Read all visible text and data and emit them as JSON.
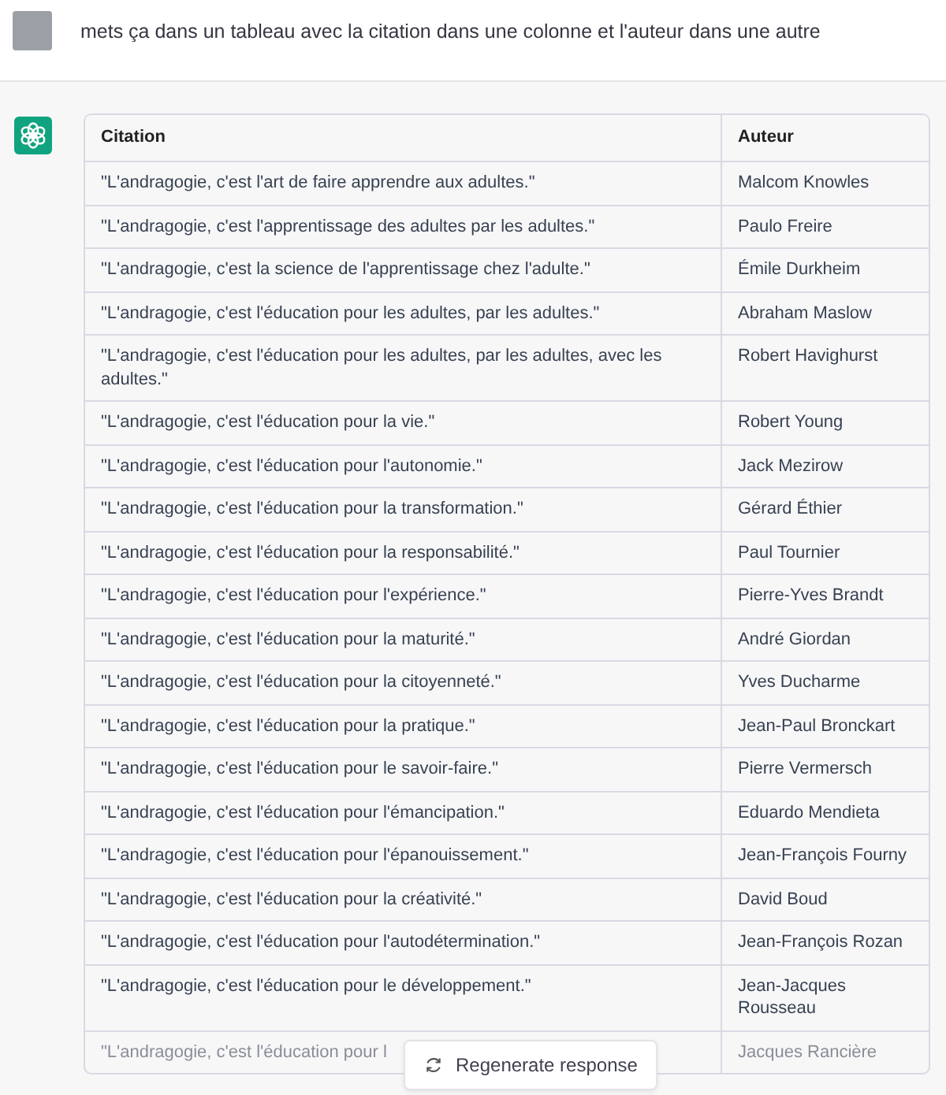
{
  "user_message": {
    "text": "mets ça dans un tableau avec la citation dans une colonne et l'auteur dans une autre"
  },
  "table": {
    "columns": [
      "Citation",
      "Auteur"
    ],
    "rows": [
      [
        "\"L'andragogie, c'est l'art de faire apprendre aux adultes.\"",
        "Malcom Knowles"
      ],
      [
        "\"L'andragogie, c'est l'apprentissage des adultes par les adultes.\"",
        "Paulo Freire"
      ],
      [
        "\"L'andragogie, c'est la science de l'apprentissage chez l'adulte.\"",
        "Émile Durkheim"
      ],
      [
        "\"L'andragogie, c'est l'éducation pour les adultes, par les adultes.\"",
        "Abraham Maslow"
      ],
      [
        "\"L'andragogie, c'est l'éducation pour les adultes, par les adultes, avec les adultes.\"",
        "Robert Havighurst"
      ],
      [
        "\"L'andragogie, c'est l'éducation pour la vie.\"",
        "Robert Young"
      ],
      [
        "\"L'andragogie, c'est l'éducation pour l'autonomie.\"",
        "Jack Mezirow"
      ],
      [
        "\"L'andragogie, c'est l'éducation pour la transformation.\"",
        "Gérard Éthier"
      ],
      [
        "\"L'andragogie, c'est l'éducation pour la responsabilité.\"",
        "Paul Tournier"
      ],
      [
        "\"L'andragogie, c'est l'éducation pour l'expérience.\"",
        "Pierre-Yves Brandt"
      ],
      [
        "\"L'andragogie, c'est l'éducation pour la maturité.\"",
        "André Giordan"
      ],
      [
        "\"L'andragogie, c'est l'éducation pour la citoyenneté.\"",
        "Yves Ducharme"
      ],
      [
        "\"L'andragogie, c'est l'éducation pour la pratique.\"",
        "Jean-Paul Bronckart"
      ],
      [
        "\"L'andragogie, c'est l'éducation pour le savoir-faire.\"",
        "Pierre Vermersch"
      ],
      [
        "\"L'andragogie, c'est l'éducation pour l'émancipation.\"",
        "Eduardo Mendieta"
      ],
      [
        "\"L'andragogie, c'est l'éducation pour l'épanouissement.\"",
        "Jean-François Fourny"
      ],
      [
        "\"L'andragogie, c'est l'éducation pour la créativité.\"",
        "David Boud"
      ],
      [
        "\"L'andragogie, c'est l'éducation pour l'autodétermination.\"",
        "Jean-François Rozan"
      ],
      [
        "\"L'andragogie, c'est l'éducation pour le développement.\"",
        "Jean-Jacques Rousseau"
      ],
      [
        "\"L'andragogie, c'est l'éducation pour l",
        "Jacques Rancière"
      ]
    ]
  },
  "regenerate_button": {
    "label": "Regenerate response"
  }
}
